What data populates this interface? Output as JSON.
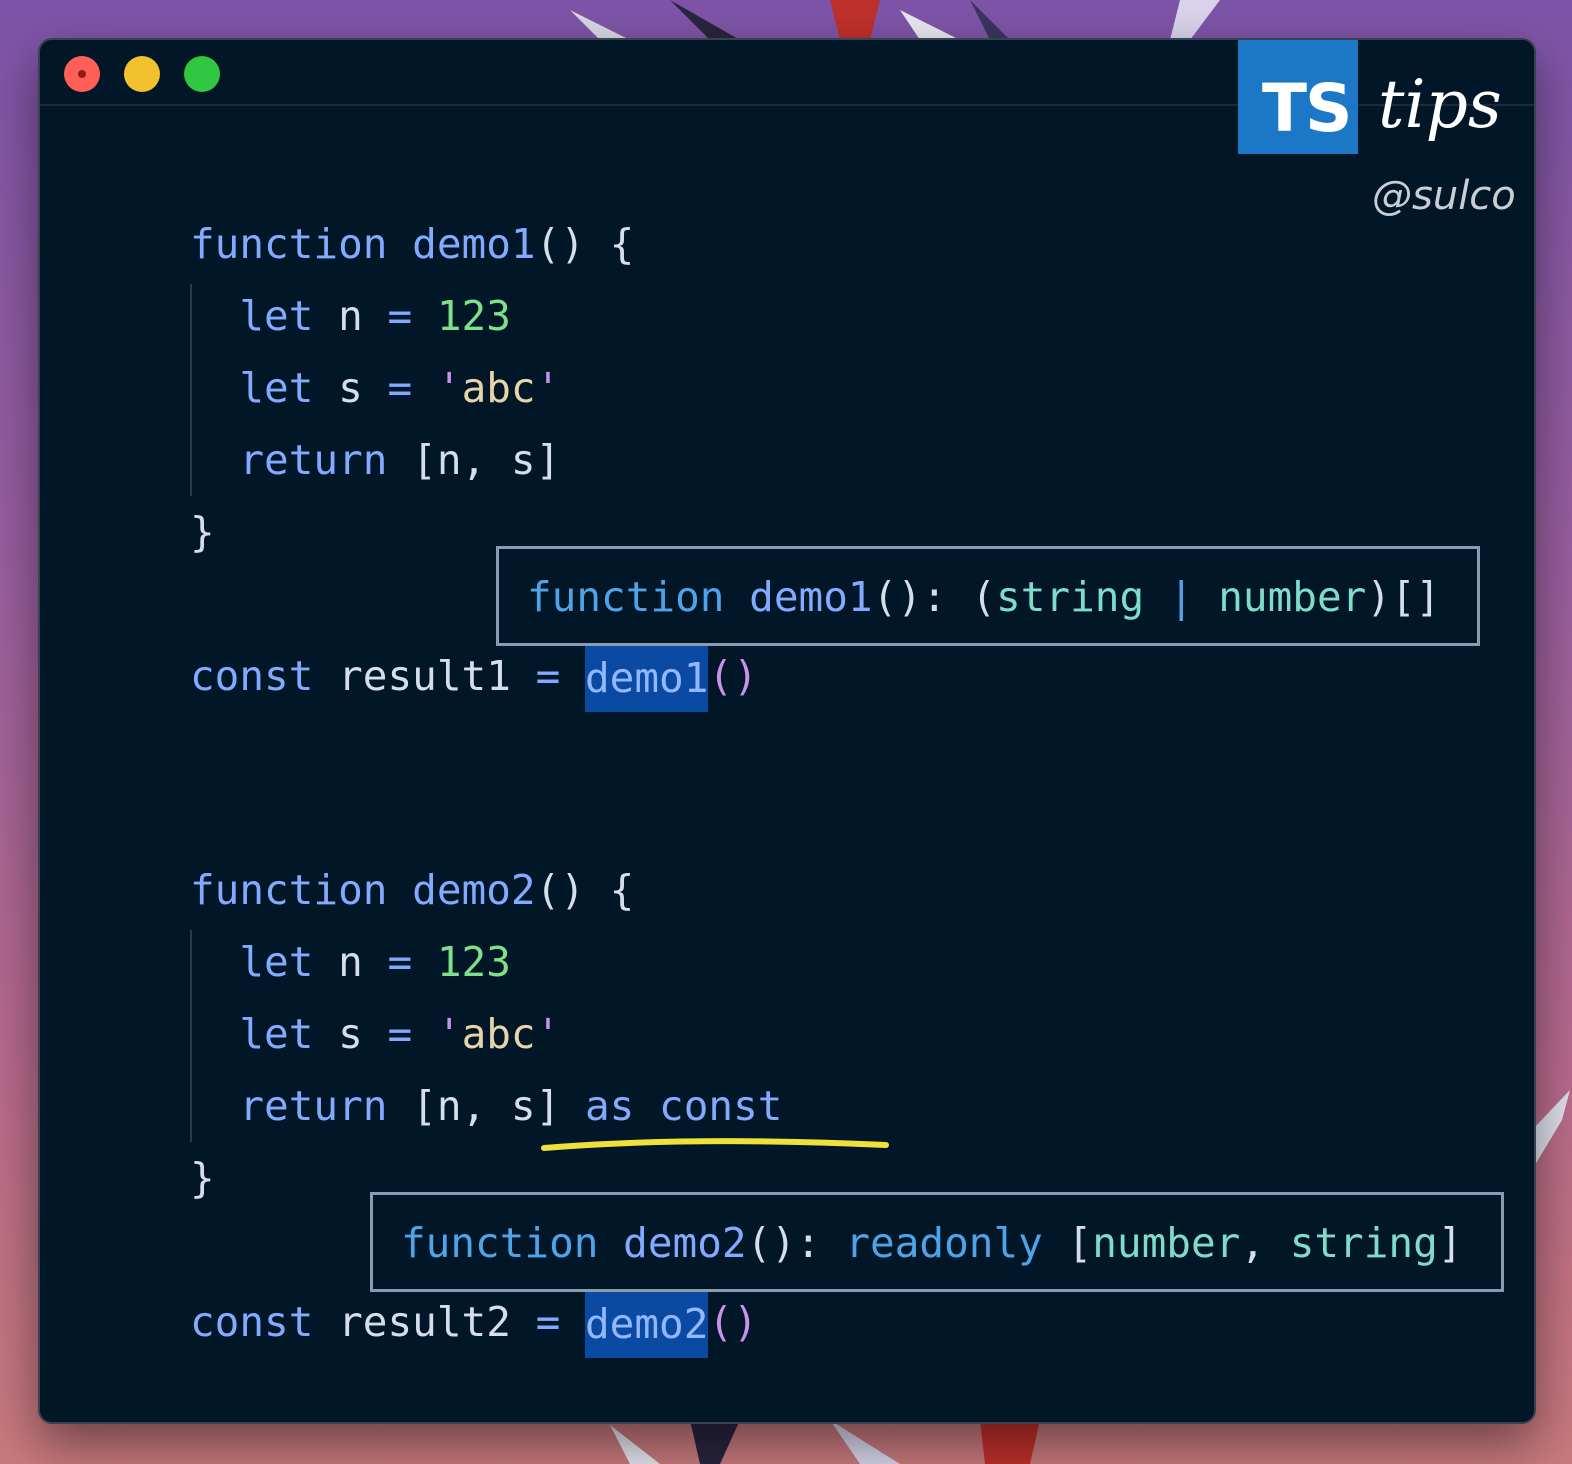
{
  "window": {
    "controls": [
      "close",
      "minimize",
      "maximize"
    ]
  },
  "brand": {
    "logo_text": "TS",
    "title": "tips",
    "handle": "@sulco"
  },
  "code": {
    "block1": {
      "l1": {
        "kw": "function",
        "name": "demo1",
        "rest": "() {"
      },
      "l2": {
        "kw": "let",
        "var": "n",
        "op": "=",
        "val": "123"
      },
      "l3": {
        "kw": "let",
        "var": "s",
        "op": "=",
        "q1": "'",
        "val": "abc",
        "q2": "'"
      },
      "l4": {
        "kw": "return",
        "rest": "[n, s]"
      },
      "l5": "}",
      "call": {
        "kw": "const",
        "var": "result1",
        "op": "=",
        "fn": "demo1",
        "parens": "()"
      }
    },
    "block2": {
      "l1": {
        "kw": "function",
        "name": "demo2",
        "rest": "() {"
      },
      "l2": {
        "kw": "let",
        "var": "n",
        "op": "=",
        "val": "123"
      },
      "l3": {
        "kw": "let",
        "var": "s",
        "op": "=",
        "q1": "'",
        "val": "abc",
        "q2": "'"
      },
      "l4": {
        "kw": "return",
        "rest": "[n, s]",
        "extra": "as const"
      },
      "l5": "}",
      "call": {
        "kw": "const",
        "var": "result2",
        "op": "=",
        "fn": "demo2",
        "parens": "()"
      }
    }
  },
  "tooltips": {
    "t1": {
      "kw": "function",
      "name": "demo1",
      "sig": "():",
      "p1": "(",
      "t1": "string",
      "sep": "|",
      "t2": "number",
      "p2": ")[]"
    },
    "t2": {
      "kw": "function",
      "name": "demo2",
      "sig": "():",
      "ro": "readonly",
      "b1": "[",
      "t1": "number",
      "comma": ",",
      "t2": "string",
      "b2": "]"
    }
  },
  "colors": {
    "editor_bg": "#011627",
    "keyword": "#82aaff",
    "number": "#7ee089",
    "type": "#7fdbca",
    "selection": "#0b4aa3",
    "underline": "#f0e03a"
  }
}
